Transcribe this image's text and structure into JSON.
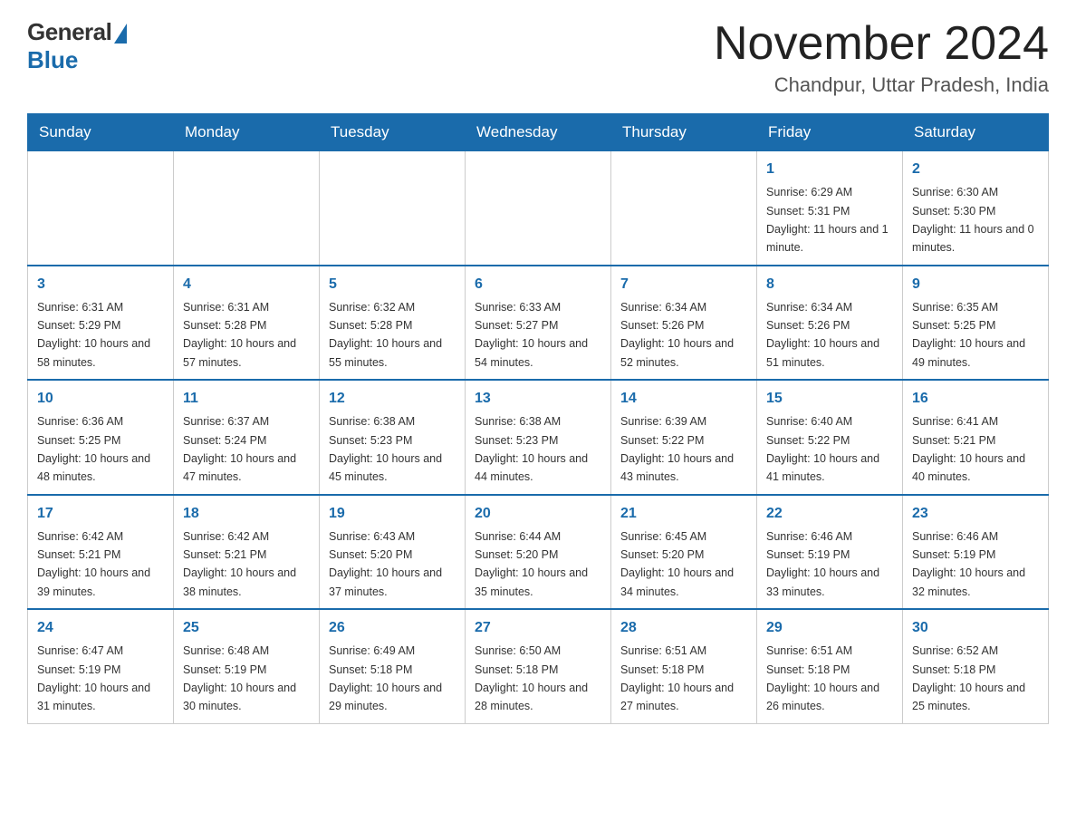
{
  "header": {
    "logo_general": "General",
    "logo_blue": "Blue",
    "title": "November 2024",
    "location": "Chandpur, Uttar Pradesh, India"
  },
  "weekdays": [
    "Sunday",
    "Monday",
    "Tuesday",
    "Wednesday",
    "Thursday",
    "Friday",
    "Saturday"
  ],
  "weeks": [
    [
      {
        "day": "",
        "info": ""
      },
      {
        "day": "",
        "info": ""
      },
      {
        "day": "",
        "info": ""
      },
      {
        "day": "",
        "info": ""
      },
      {
        "day": "",
        "info": ""
      },
      {
        "day": "1",
        "info": "Sunrise: 6:29 AM\nSunset: 5:31 PM\nDaylight: 11 hours and 1 minute."
      },
      {
        "day": "2",
        "info": "Sunrise: 6:30 AM\nSunset: 5:30 PM\nDaylight: 11 hours and 0 minutes."
      }
    ],
    [
      {
        "day": "3",
        "info": "Sunrise: 6:31 AM\nSunset: 5:29 PM\nDaylight: 10 hours and 58 minutes."
      },
      {
        "day": "4",
        "info": "Sunrise: 6:31 AM\nSunset: 5:28 PM\nDaylight: 10 hours and 57 minutes."
      },
      {
        "day": "5",
        "info": "Sunrise: 6:32 AM\nSunset: 5:28 PM\nDaylight: 10 hours and 55 minutes."
      },
      {
        "day": "6",
        "info": "Sunrise: 6:33 AM\nSunset: 5:27 PM\nDaylight: 10 hours and 54 minutes."
      },
      {
        "day": "7",
        "info": "Sunrise: 6:34 AM\nSunset: 5:26 PM\nDaylight: 10 hours and 52 minutes."
      },
      {
        "day": "8",
        "info": "Sunrise: 6:34 AM\nSunset: 5:26 PM\nDaylight: 10 hours and 51 minutes."
      },
      {
        "day": "9",
        "info": "Sunrise: 6:35 AM\nSunset: 5:25 PM\nDaylight: 10 hours and 49 minutes."
      }
    ],
    [
      {
        "day": "10",
        "info": "Sunrise: 6:36 AM\nSunset: 5:25 PM\nDaylight: 10 hours and 48 minutes."
      },
      {
        "day": "11",
        "info": "Sunrise: 6:37 AM\nSunset: 5:24 PM\nDaylight: 10 hours and 47 minutes."
      },
      {
        "day": "12",
        "info": "Sunrise: 6:38 AM\nSunset: 5:23 PM\nDaylight: 10 hours and 45 minutes."
      },
      {
        "day": "13",
        "info": "Sunrise: 6:38 AM\nSunset: 5:23 PM\nDaylight: 10 hours and 44 minutes."
      },
      {
        "day": "14",
        "info": "Sunrise: 6:39 AM\nSunset: 5:22 PM\nDaylight: 10 hours and 43 minutes."
      },
      {
        "day": "15",
        "info": "Sunrise: 6:40 AM\nSunset: 5:22 PM\nDaylight: 10 hours and 41 minutes."
      },
      {
        "day": "16",
        "info": "Sunrise: 6:41 AM\nSunset: 5:21 PM\nDaylight: 10 hours and 40 minutes."
      }
    ],
    [
      {
        "day": "17",
        "info": "Sunrise: 6:42 AM\nSunset: 5:21 PM\nDaylight: 10 hours and 39 minutes."
      },
      {
        "day": "18",
        "info": "Sunrise: 6:42 AM\nSunset: 5:21 PM\nDaylight: 10 hours and 38 minutes."
      },
      {
        "day": "19",
        "info": "Sunrise: 6:43 AM\nSunset: 5:20 PM\nDaylight: 10 hours and 37 minutes."
      },
      {
        "day": "20",
        "info": "Sunrise: 6:44 AM\nSunset: 5:20 PM\nDaylight: 10 hours and 35 minutes."
      },
      {
        "day": "21",
        "info": "Sunrise: 6:45 AM\nSunset: 5:20 PM\nDaylight: 10 hours and 34 minutes."
      },
      {
        "day": "22",
        "info": "Sunrise: 6:46 AM\nSunset: 5:19 PM\nDaylight: 10 hours and 33 minutes."
      },
      {
        "day": "23",
        "info": "Sunrise: 6:46 AM\nSunset: 5:19 PM\nDaylight: 10 hours and 32 minutes."
      }
    ],
    [
      {
        "day": "24",
        "info": "Sunrise: 6:47 AM\nSunset: 5:19 PM\nDaylight: 10 hours and 31 minutes."
      },
      {
        "day": "25",
        "info": "Sunrise: 6:48 AM\nSunset: 5:19 PM\nDaylight: 10 hours and 30 minutes."
      },
      {
        "day": "26",
        "info": "Sunrise: 6:49 AM\nSunset: 5:18 PM\nDaylight: 10 hours and 29 minutes."
      },
      {
        "day": "27",
        "info": "Sunrise: 6:50 AM\nSunset: 5:18 PM\nDaylight: 10 hours and 28 minutes."
      },
      {
        "day": "28",
        "info": "Sunrise: 6:51 AM\nSunset: 5:18 PM\nDaylight: 10 hours and 27 minutes."
      },
      {
        "day": "29",
        "info": "Sunrise: 6:51 AM\nSunset: 5:18 PM\nDaylight: 10 hours and 26 minutes."
      },
      {
        "day": "30",
        "info": "Sunrise: 6:52 AM\nSunset: 5:18 PM\nDaylight: 10 hours and 25 minutes."
      }
    ]
  ]
}
